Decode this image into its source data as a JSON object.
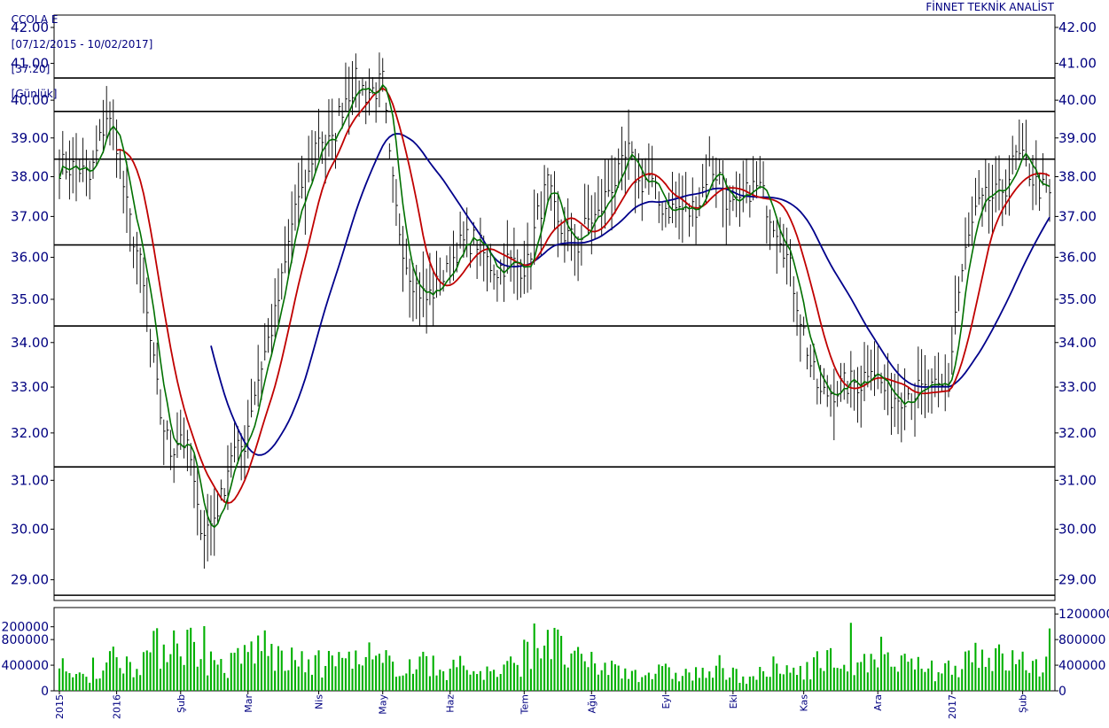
{
  "header": {
    "ticker": "CCOLA E",
    "range": "[07/12/2015 - 10/02/2017]",
    "last": "[37.20]",
    "period": "[Günlük]",
    "brand": "FİNNET TEKNİK ANALİST"
  },
  "colors": {
    "price_bars": "#000000",
    "ma_short": "#007000",
    "ma_mid": "#c00000",
    "ma_long": "#00008b",
    "volume": "#00b000",
    "axis_text": "#000080",
    "support_lines": "#000000"
  },
  "chart_data": [
    {
      "type": "line",
      "name_hint": "price",
      "y_ticks": [
        "42.00",
        "41.00",
        "40.00",
        "39.00",
        "38.00",
        "37.00",
        "36.00",
        "35.00",
        "34.00",
        "33.00",
        "32.00",
        "31.00",
        "30.00",
        "29.00"
      ],
      "ylim": [
        28.6,
        42.35
      ],
      "y_log": true,
      "x_labels": [
        {
          "i": 0,
          "label": "2015"
        },
        {
          "i": 17,
          "label": "2016"
        },
        {
          "i": 36,
          "label": "Şub"
        },
        {
          "i": 56,
          "label": "Mar"
        },
        {
          "i": 77,
          "label": "Nis"
        },
        {
          "i": 96,
          "label": "May"
        },
        {
          "i": 116,
          "label": "Haz"
        },
        {
          "i": 138,
          "label": "Tem"
        },
        {
          "i": 158,
          "label": "Ağu"
        },
        {
          "i": 180,
          "label": "Eyl"
        },
        {
          "i": 200,
          "label": "Eki"
        },
        {
          "i": 221,
          "label": "Kas"
        },
        {
          "i": 243,
          "label": "Ara"
        },
        {
          "i": 265,
          "label": "2017"
        },
        {
          "i": 286,
          "label": "Şub"
        }
      ],
      "x_count": 295,
      "horizontal_levels": [
        40.6,
        39.7,
        38.45,
        36.3,
        34.38,
        31.28,
        28.7
      ],
      "close_keyframes": [
        [
          0,
          38.3
        ],
        [
          6,
          38.2
        ],
        [
          9,
          37.9
        ],
        [
          14,
          39.6
        ],
        [
          17,
          38.9
        ],
        [
          20,
          37.2
        ],
        [
          24,
          35.8
        ],
        [
          27,
          34.0
        ],
        [
          30,
          32.4
        ],
        [
          33,
          31.6
        ],
        [
          36,
          32.0
        ],
        [
          39,
          31.4
        ],
        [
          41,
          30.3
        ],
        [
          43,
          30.0
        ],
        [
          45,
          30.1
        ],
        [
          48,
          30.6
        ],
        [
          51,
          31.6
        ],
        [
          53,
          31.6
        ],
        [
          55,
          31.8
        ],
        [
          57,
          32.6
        ],
        [
          60,
          33.5
        ],
        [
          64,
          34.6
        ],
        [
          67,
          35.8
        ],
        [
          70,
          37.3
        ],
        [
          73,
          37.5
        ],
        [
          75,
          38.5
        ],
        [
          77,
          39.1
        ],
        [
          79,
          38.9
        ],
        [
          81,
          38.8
        ],
        [
          83,
          39.6
        ],
        [
          85,
          40.1
        ],
        [
          88,
          40.5
        ],
        [
          91,
          40.2
        ],
        [
          94,
          40.3
        ],
        [
          96,
          40.5
        ],
        [
          98,
          38.4
        ],
        [
          100,
          37.1
        ],
        [
          103,
          35.9
        ],
        [
          106,
          35.3
        ],
        [
          109,
          35.0
        ],
        [
          112,
          35.3
        ],
        [
          115,
          35.6
        ],
        [
          118,
          36.2
        ],
        [
          121,
          36.4
        ],
        [
          124,
          36.4
        ],
        [
          127,
          35.9
        ],
        [
          130,
          35.7
        ],
        [
          133,
          35.9
        ],
        [
          136,
          35.8
        ],
        [
          139,
          35.8
        ],
        [
          142,
          37.0
        ],
        [
          145,
          37.8
        ],
        [
          148,
          36.7
        ],
        [
          151,
          36.5
        ],
        [
          154,
          36.3
        ],
        [
          157,
          36.9
        ],
        [
          160,
          37.0
        ],
        [
          163,
          37.7
        ],
        [
          166,
          38.0
        ],
        [
          169,
          38.6
        ],
        [
          172,
          37.8
        ],
        [
          175,
          38.0
        ],
        [
          178,
          37.3
        ],
        [
          181,
          37.2
        ],
        [
          184,
          37.2
        ],
        [
          187,
          37.1
        ],
        [
          190,
          37.4
        ],
        [
          193,
          38.3
        ],
        [
          196,
          38.0
        ],
        [
          199,
          37.2
        ],
        [
          202,
          37.2
        ],
        [
          205,
          37.7
        ],
        [
          208,
          37.7
        ],
        [
          211,
          37.1
        ],
        [
          214,
          36.6
        ],
        [
          217,
          35.7
        ],
        [
          220,
          34.6
        ],
        [
          223,
          33.5
        ],
        [
          226,
          32.8
        ],
        [
          229,
          32.9
        ],
        [
          232,
          33.0
        ],
        [
          235,
          33.1
        ],
        [
          238,
          33.1
        ],
        [
          241,
          33.6
        ],
        [
          243,
          33.2
        ],
        [
          246,
          32.8
        ],
        [
          249,
          32.8
        ],
        [
          252,
          32.9
        ],
        [
          255,
          32.9
        ],
        [
          258,
          32.9
        ],
        [
          261,
          32.9
        ],
        [
          264,
          33.0
        ],
        [
          266,
          34.7
        ],
        [
          269,
          36.1
        ],
        [
          272,
          37.1
        ],
        [
          275,
          37.4
        ],
        [
          278,
          37.5
        ],
        [
          281,
          37.8
        ],
        [
          284,
          38.5
        ],
        [
          287,
          38.3
        ],
        [
          290,
          37.8
        ],
        [
          294,
          37.5
        ]
      ],
      "ma_mid_start": 17,
      "ma_long_start": 45,
      "ma_short_period": 5,
      "ma_mid_period": 12,
      "ma_long_period": 32
    },
    {
      "type": "bar",
      "name_hint": "volume",
      "y_ticks": [
        "200000",
        "800000",
        "400000",
        "0"
      ],
      "y_ticks_right": [
        "1200000",
        "800000",
        "400000",
        "0"
      ],
      "ylim": [
        0,
        1300000
      ],
      "vol_keyframes": [
        [
          0,
          230000
        ],
        [
          6,
          260000
        ],
        [
          12,
          280000
        ],
        [
          17,
          560000
        ],
        [
          21,
          420000
        ],
        [
          26,
          560000
        ],
        [
          30,
          680000
        ],
        [
          35,
          880000
        ],
        [
          40,
          680000
        ],
        [
          45,
          440000
        ],
        [
          50,
          360000
        ],
        [
          56,
          600000
        ],
        [
          60,
          720000
        ],
        [
          65,
          520000
        ],
        [
          70,
          420000
        ],
        [
          75,
          400000
        ],
        [
          80,
          430000
        ],
        [
          85,
          520000
        ],
        [
          90,
          380000
        ],
        [
          96,
          420000
        ],
        [
          100,
          450000
        ],
        [
          106,
          380000
        ],
        [
          112,
          330000
        ],
        [
          118,
          350000
        ],
        [
          124,
          300000
        ],
        [
          130,
          270000
        ],
        [
          136,
          420000
        ],
        [
          140,
          680000
        ],
        [
          145,
          780000
        ],
        [
          150,
          560000
        ],
        [
          155,
          420000
        ],
        [
          160,
          380000
        ],
        [
          165,
          340000
        ],
        [
          170,
          300000
        ],
        [
          175,
          280000
        ],
        [
          180,
          280000
        ],
        [
          186,
          260000
        ],
        [
          192,
          270000
        ],
        [
          198,
          250000
        ],
        [
          204,
          240000
        ],
        [
          210,
          250000
        ],
        [
          216,
          300000
        ],
        [
          222,
          380000
        ],
        [
          228,
          470000
        ],
        [
          234,
          450000
        ],
        [
          240,
          380000
        ],
        [
          246,
          420000
        ],
        [
          252,
          390000
        ],
        [
          258,
          300000
        ],
        [
          264,
          360000
        ],
        [
          268,
          470000
        ],
        [
          272,
          640000
        ],
        [
          276,
          560000
        ],
        [
          280,
          470000
        ],
        [
          285,
          460000
        ],
        [
          290,
          380000
        ],
        [
          294,
          430000
        ]
      ]
    }
  ]
}
